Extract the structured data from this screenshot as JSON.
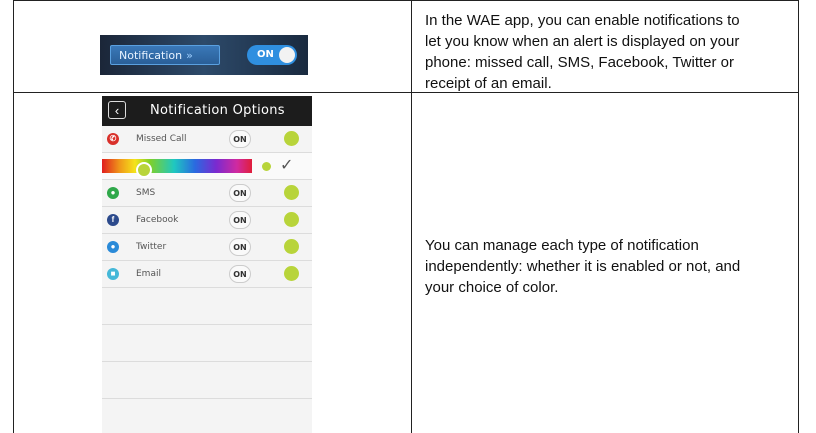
{
  "row1": {
    "text": "In the WAE app, you can enable notifications to let you know when an alert is displayed on your phone: missed call, SMS, Facebook, Twitter or receipt of an email.",
    "lines": [
      "In the WAE app, you can enable notifications to",
      "let you know when an alert is displayed on your",
      "phone: missed call, SMS, Facebook, Twitter or",
      "receipt of an email."
    ],
    "banner": {
      "button_label": "Notification",
      "chevron_icon": "double-chevron-right-icon",
      "toggle_label": "ON"
    }
  },
  "row2": {
    "lines": [
      "You can manage each type of notification",
      "independently: whether it is enabled or not, and",
      "your choice of color."
    ],
    "screen": {
      "title": "Notification Options",
      "back_icon": "chevron-left-icon",
      "items": [
        {
          "label": "Missed Call",
          "toggle": "ON",
          "icon": "phone-icon",
          "icon_color": "#d9302a"
        },
        {
          "label": "SMS",
          "toggle": "ON",
          "icon": "sms-icon",
          "icon_color": "#2fa84a"
        },
        {
          "label": "Facebook",
          "toggle": "ON",
          "icon": "facebook-icon",
          "icon_color": "#2c4a8c"
        },
        {
          "label": "Twitter",
          "toggle": "ON",
          "icon": "twitter-icon",
          "icon_color": "#2a8ad8"
        },
        {
          "label": "Email",
          "toggle": "ON",
          "icon": "email-icon",
          "icon_color": "#45b8d8"
        }
      ],
      "selected_color": "#b8d43a",
      "check_icon": "checkmark-icon"
    }
  }
}
